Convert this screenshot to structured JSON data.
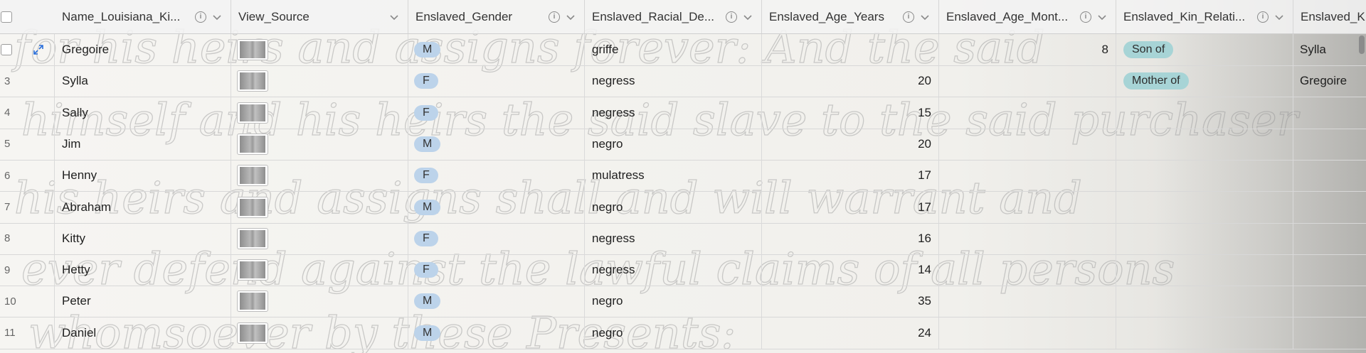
{
  "columns": [
    {
      "label": "Name_Louisiana_Ki...",
      "info": true
    },
    {
      "label": "View_Source",
      "info": false
    },
    {
      "label": "Enslaved_Gender",
      "info": true
    },
    {
      "label": "Enslaved_Racial_De...",
      "info": true
    },
    {
      "label": "Enslaved_Age_Years",
      "info": true
    },
    {
      "label": "Enslaved_Age_Mont...",
      "info": true
    },
    {
      "label": "Enslaved_Kin_Relati...",
      "info": true
    },
    {
      "label": "Enslaved_K",
      "info": false
    }
  ],
  "rows": [
    {
      "num": "",
      "name": "Gregoire",
      "gender": "M",
      "racial": "griffe",
      "age_years": "",
      "age_months": "8",
      "kin": "Son of",
      "kin_name": "Sylla"
    },
    {
      "num": "3",
      "name": "Sylla",
      "gender": "F",
      "racial": "negress",
      "age_years": "20",
      "age_months": "",
      "kin": "Mother of",
      "kin_name": "Gregoire"
    },
    {
      "num": "4",
      "name": "Sally",
      "gender": "F",
      "racial": "negress",
      "age_years": "15",
      "age_months": "",
      "kin": "",
      "kin_name": ""
    },
    {
      "num": "5",
      "name": "Jim",
      "gender": "M",
      "racial": "negro",
      "age_years": "20",
      "age_months": "",
      "kin": "",
      "kin_name": ""
    },
    {
      "num": "6",
      "name": "Henny",
      "gender": "F",
      "racial": "mulatress",
      "age_years": "17",
      "age_months": "",
      "kin": "",
      "kin_name": ""
    },
    {
      "num": "7",
      "name": "Abraham",
      "gender": "M",
      "racial": "negro",
      "age_years": "17",
      "age_months": "",
      "kin": "",
      "kin_name": ""
    },
    {
      "num": "8",
      "name": "Kitty",
      "gender": "F",
      "racial": "negress",
      "age_years": "16",
      "age_months": "",
      "kin": "",
      "kin_name": ""
    },
    {
      "num": "9",
      "name": "Hetty",
      "gender": "F",
      "racial": "negress",
      "age_years": "14",
      "age_months": "",
      "kin": "",
      "kin_name": ""
    },
    {
      "num": "10",
      "name": "Peter",
      "gender": "M",
      "racial": "negro",
      "age_years": "35",
      "age_months": "",
      "kin": "",
      "kin_name": ""
    },
    {
      "num": "11",
      "name": "Daniel",
      "gender": "M",
      "racial": "negro",
      "age_years": "24",
      "age_months": "",
      "kin": "",
      "kin_name": ""
    }
  ],
  "background": {
    "lines": [
      "for his heirs and assigns forever: And the said",
      "himself and his heirs the said slave to the said purchaser",
      "his heirs and assigns shall and will warrant and",
      "ever defend against the lawful claims of all persons",
      "whomsoever by these Presents:"
    ]
  },
  "icons": {
    "info": "info-icon",
    "chevron": "chevron-down-icon",
    "expand": "expand-record-icon",
    "thumb": "document-thumbnail-icon"
  }
}
